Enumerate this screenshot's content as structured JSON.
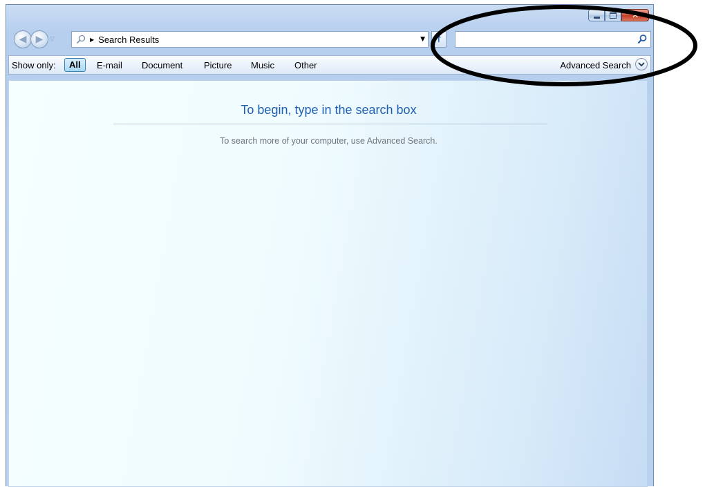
{
  "address": {
    "breadcrumb": "Search Results"
  },
  "search": {
    "value": "",
    "placeholder": ""
  },
  "filter_bar": {
    "show_only_label": "Show only:",
    "filters": [
      "All",
      "E-mail",
      "Document",
      "Picture",
      "Music",
      "Other"
    ],
    "selected": "All",
    "advanced_search_label": "Advanced Search"
  },
  "content": {
    "title": "To begin, type in the search box",
    "hint": "To search more of your computer, use Advanced Search."
  },
  "icons": {
    "back": "arrow-left-icon",
    "forward": "arrow-right-icon",
    "search": "magnifier-icon",
    "refresh": "refresh-icon",
    "minimize": "minimize-icon",
    "maximize": "maximize-icon",
    "close": "close-icon",
    "chevron": "chevron-down-icon"
  },
  "colors": {
    "title_blue": "#1f5fb0",
    "annotation": "#000000",
    "close_red": "#c13b22"
  }
}
